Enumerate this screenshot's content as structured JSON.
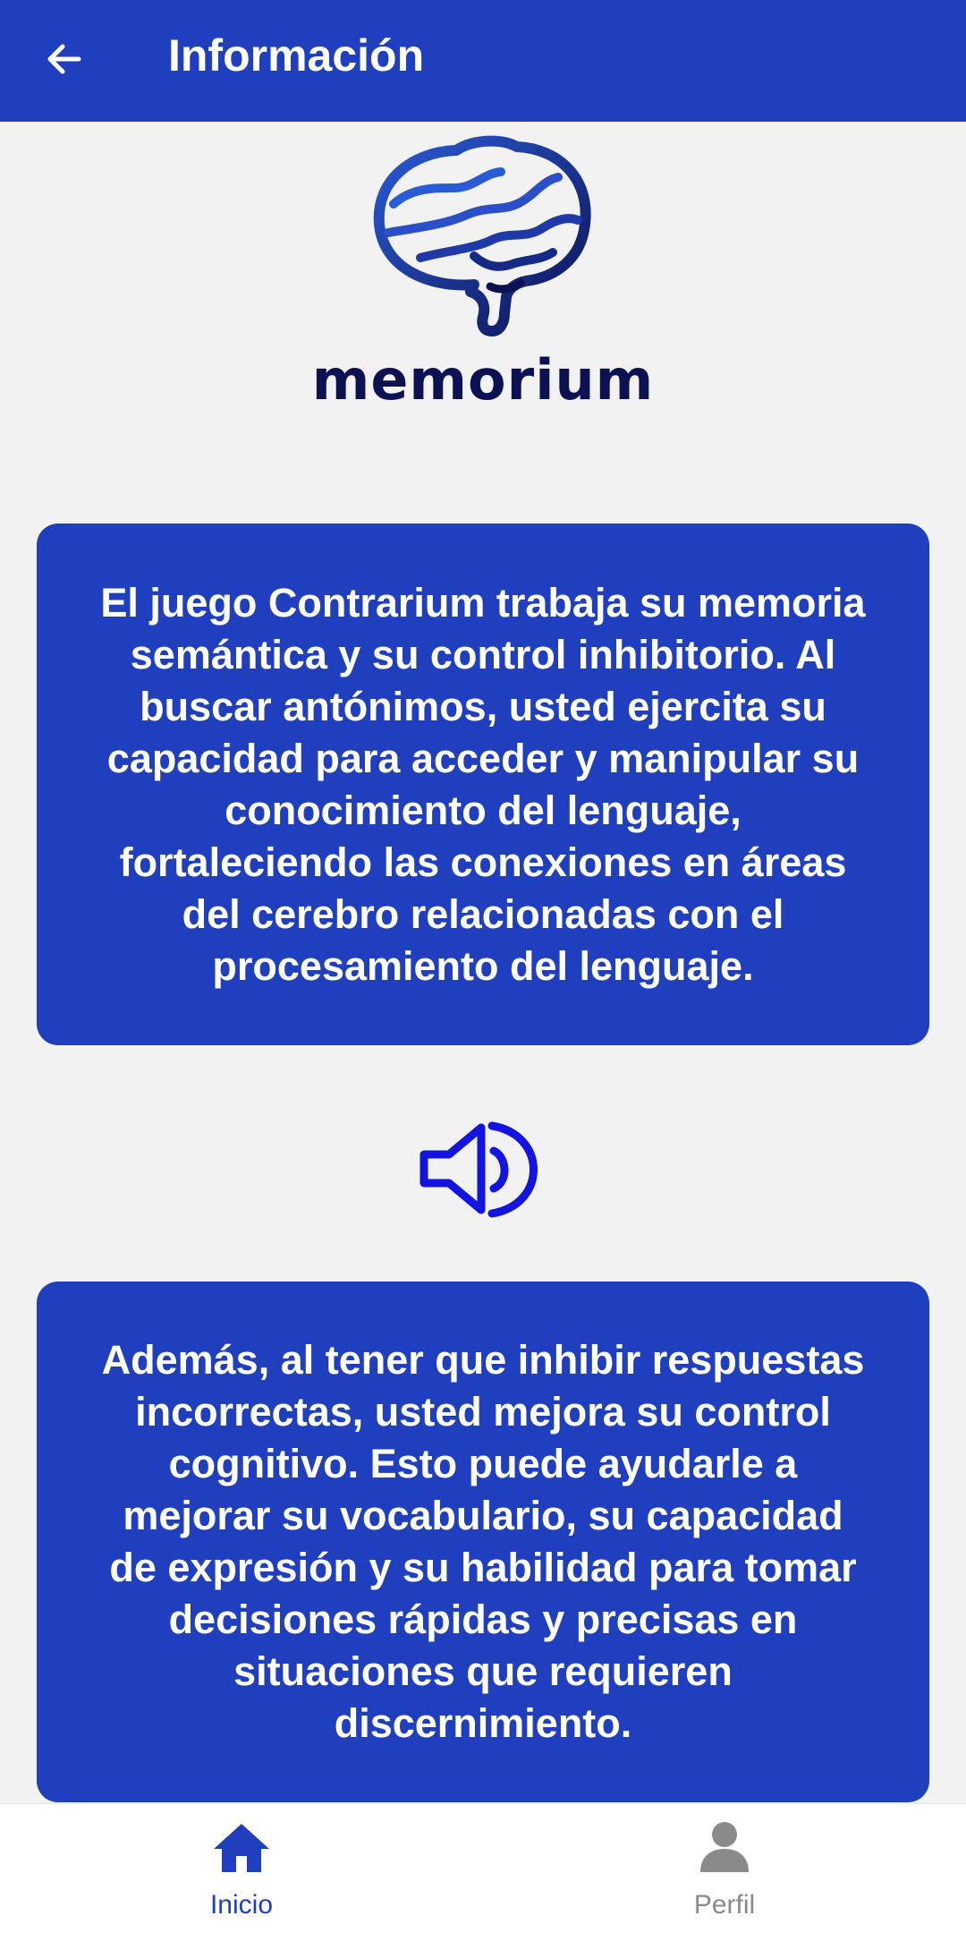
{
  "header": {
    "title": "Información"
  },
  "logo": {
    "brand_name": "memorium"
  },
  "cards": {
    "first": "El juego Contrarium trabaja su memoria semántica y su control inhibitorio. Al buscar antónimos, usted ejercita su capacidad para acceder y manipular su conocimiento del lenguaje, fortaleciendo las conexiones en áreas del cerebro relacionadas con el procesamiento del lenguaje.",
    "second": "Además, al tener que inhibir respuestas incorrectas, usted mejora su control cognitivo. Esto puede ayudarle a mejorar su vocabulario, su capacidad de expresión y su habilidad para tomar decisiones rápidas y precisas en situaciones que requieren discernimiento."
  },
  "bottom_nav": {
    "items": [
      {
        "label": "Inicio",
        "icon": "home-icon",
        "active": true
      },
      {
        "label": "Perfil",
        "icon": "person-icon",
        "active": false
      }
    ]
  },
  "colors": {
    "primary": "#1f3fbe",
    "brand_dark": "#0c1152",
    "speaker": "#1414e0",
    "inactive": "#8a8a8a"
  }
}
